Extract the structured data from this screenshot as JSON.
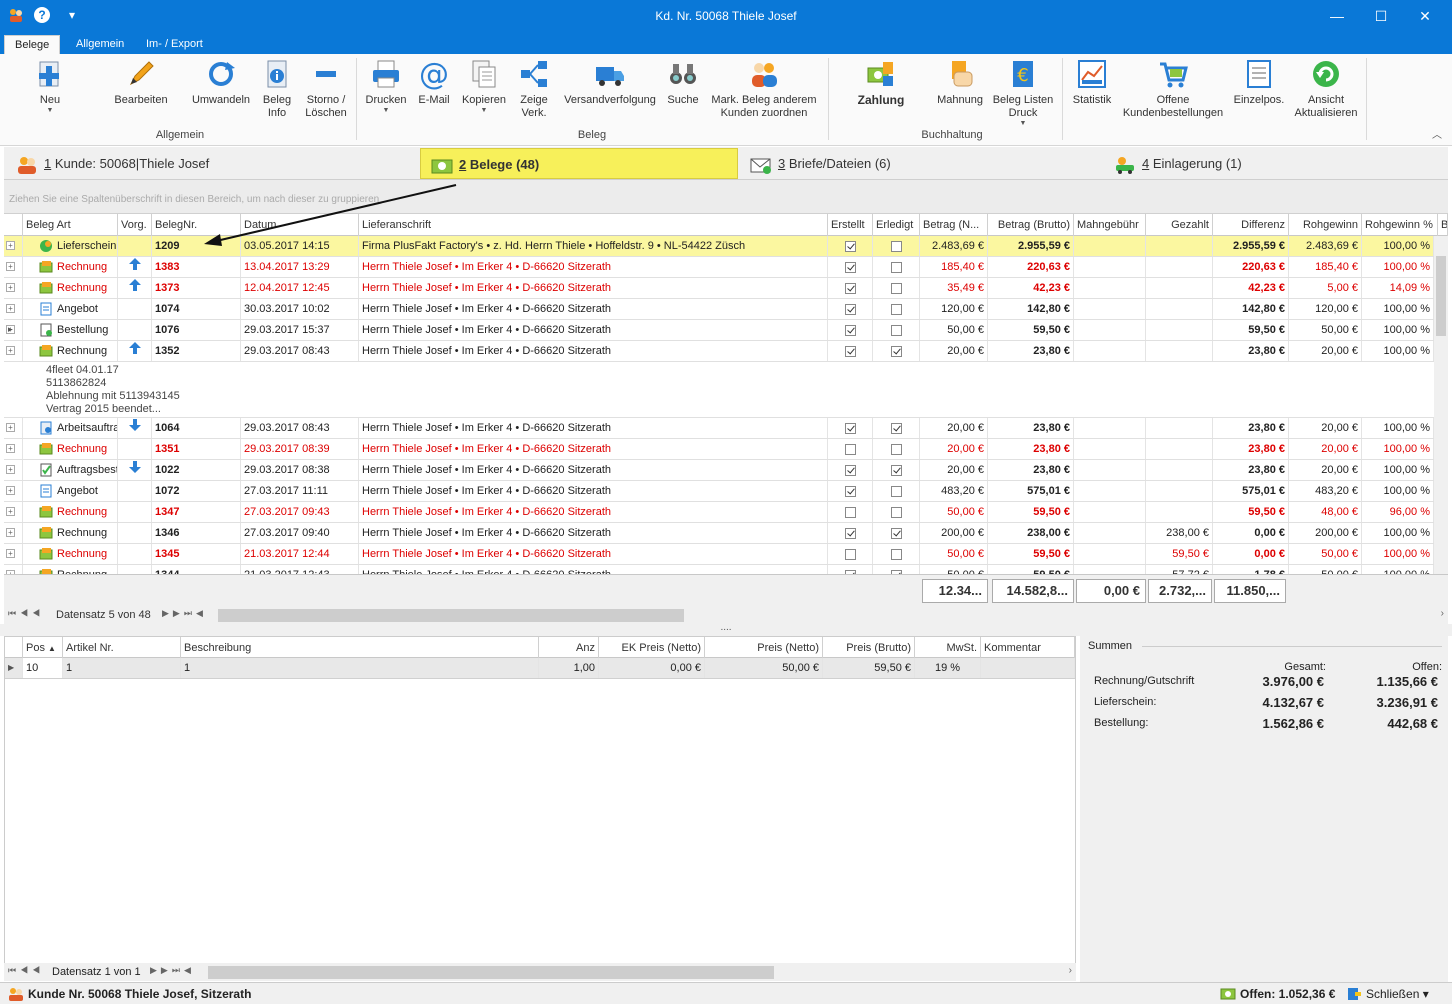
{
  "window": {
    "title": "Kd. Nr. 50068 Thiele Josef",
    "qa_help": "?",
    "qa_menu": "▾",
    "min": "—",
    "max": "☐",
    "close": "✕"
  },
  "ribbon_tabs": [
    "Belege",
    "Allgemein",
    "Im- / Export"
  ],
  "ribbon": {
    "buttons": {
      "neu": "Neu",
      "bearbeiten": "Bearbeiten",
      "umwandeln": "Umwandeln",
      "beleg_info": "Beleg Info",
      "storno": "Storno / Löschen",
      "drucken": "Drucken",
      "email": "E-Mail",
      "kopieren": "Kopieren",
      "zeige": "Zeige Verk.",
      "versand": "Versandverfolgung",
      "suche": "Suche",
      "mark": "Mark. Beleg  anderem Kunden zuordnen",
      "zahlung": "Zahlung",
      "mahnung": "Mahnung",
      "beleglisten": "Beleg Listen Druck",
      "statistik": "Statistik",
      "offene": "Offene Kundenbestellungen",
      "einzelpos": "Einzelpos.",
      "ansicht": "Ansicht Aktualisieren"
    },
    "groups": {
      "allgemein": "Allgemein",
      "beleg": "Beleg",
      "buchhaltung": "Buchhaltung"
    }
  },
  "main_tabs": [
    {
      "num": "1",
      "label": " Kunde: 50068|Thiele Josef"
    },
    {
      "num": "2",
      "label": " Belege (48)"
    },
    {
      "num": "3",
      "label": " Briefe/Dateien (6)"
    },
    {
      "num": "4",
      "label": " Einlagerung (1)"
    }
  ],
  "group_hint": "Ziehen Sie eine Spaltenüberschrift in diesen Bereich, um nach dieser zu gruppieren",
  "columns": [
    "Beleg Art",
    "Vorg.",
    "BelegNr.",
    "Datum",
    "Lieferanschrift",
    "Erstellt",
    "Erledigt",
    "Betrag (N...",
    "Betrag (Brutto)",
    "Mahngebühr",
    "Gezahlt",
    "Differenz",
    "Rohgewinn",
    "Rohgewinn %",
    "B"
  ],
  "rows": [
    {
      "art": "Lieferschein",
      "vorg": "",
      "nr": "1209",
      "datum": "03.05.2017 14:15",
      "anschrift": "Firma PlusFakt Factory's • z. Hd. Herrn Thiele • Hoffeldstr. 9 • NL-54422 Züsch",
      "erstellt": true,
      "erledigt": false,
      "netto": "2.483,69 €",
      "brutto": "2.955,59 €",
      "mahn": "",
      "gezahlt": "",
      "diff": "2.955,59 €",
      "roh": "2.483,69 €",
      "rohp": "100,00 %",
      "sel": true,
      "red": false,
      "type": "liefer"
    },
    {
      "art": "Rechnung",
      "vorg": "up",
      "nr": "1383",
      "datum": "13.04.2017 13:29",
      "anschrift": "Herrn Thiele Josef • Im Erker 4 • D-66620 Sitzerath",
      "erstellt": true,
      "erledigt": false,
      "netto": "185,40 €",
      "brutto": "220,63 €",
      "mahn": "",
      "gezahlt": "",
      "diff": "220,63 €",
      "roh": "185,40 €",
      "rohp": "100,00 %",
      "red": true,
      "type": "rech"
    },
    {
      "art": "Rechnung",
      "vorg": "up",
      "nr": "1373",
      "datum": "12.04.2017 12:45",
      "anschrift": "Herrn Thiele Josef • Im Erker 4 • D-66620 Sitzerath",
      "erstellt": true,
      "erledigt": false,
      "netto": "35,49 €",
      "brutto": "42,23 €",
      "mahn": "",
      "gezahlt": "",
      "diff": "42,23 €",
      "roh": "5,00 €",
      "rohp": "14,09 %",
      "red": true,
      "type": "rech"
    },
    {
      "art": "Angebot",
      "vorg": "",
      "nr": "1074",
      "datum": "30.03.2017 10:02",
      "anschrift": "Herrn Thiele Josef • Im Erker 4 • D-66620 Sitzerath",
      "erstellt": true,
      "erledigt": false,
      "netto": "120,00 €",
      "brutto": "142,80 €",
      "mahn": "",
      "gezahlt": "",
      "diff": "142,80 €",
      "roh": "120,00 €",
      "rohp": "100,00 %",
      "red": false,
      "type": "angebot"
    },
    {
      "art": "Bestellung",
      "vorg": "",
      "nr": "1076",
      "datum": "29.03.2017 15:37",
      "anschrift": "Herrn Thiele Josef • Im Erker 4 • D-66620 Sitzerath",
      "erstellt": true,
      "erledigt": false,
      "netto": "50,00 €",
      "brutto": "59,50 €",
      "mahn": "",
      "gezahlt": "",
      "diff": "59,50 €",
      "roh": "50,00 €",
      "rohp": "100,00 %",
      "red": false,
      "type": "bestell"
    },
    {
      "art": "Rechnung",
      "vorg": "up",
      "nr": "1352",
      "datum": "29.03.2017 08:43",
      "anschrift": "Herrn Thiele Josef • Im Erker 4 • D-66620 Sitzerath",
      "erstellt": true,
      "erledigt": true,
      "netto": "20,00 €",
      "brutto": "23,80 €",
      "mahn": "",
      "gezahlt": "",
      "diff": "23,80 €",
      "roh": "20,00 €",
      "rohp": "100,00 %",
      "red": false,
      "type": "rech"
    }
  ],
  "note_lines": [
    "4fleet 04.01.17",
    "5113862824",
    "Ablehnung mit 5113943145",
    "Vertrag 2015 beendet..."
  ],
  "rows2": [
    {
      "art": "Arbeitsauftrag",
      "vorg": "down",
      "nr": "1064",
      "datum": "29.03.2017 08:43",
      "anschrift": "Herrn Thiele Josef • Im Erker 4 • D-66620 Sitzerath",
      "erstellt": true,
      "erledigt": true,
      "netto": "20,00 €",
      "brutto": "23,80 €",
      "mahn": "",
      "gezahlt": "",
      "diff": "23,80 €",
      "roh": "20,00 €",
      "rohp": "100,00 %",
      "red": false,
      "type": "arbeit"
    },
    {
      "art": "Rechnung",
      "vorg": "",
      "nr": "1351",
      "datum": "29.03.2017 08:39",
      "anschrift": "Herrn Thiele Josef • Im Erker 4 • D-66620 Sitzerath",
      "erstellt": false,
      "erledigt": false,
      "netto": "20,00 €",
      "brutto": "23,80 €",
      "mahn": "",
      "gezahlt": "",
      "diff": "23,80 €",
      "roh": "20,00 €",
      "rohp": "100,00 %",
      "red": true,
      "type": "rech"
    },
    {
      "art": "Auftragsbestätigung",
      "vorg": "down",
      "nr": "1022",
      "datum": "29.03.2017 08:38",
      "anschrift": "Herrn Thiele Josef • Im Erker 4 • D-66620 Sitzerath",
      "erstellt": true,
      "erledigt": true,
      "netto": "20,00 €",
      "brutto": "23,80 €",
      "mahn": "",
      "gezahlt": "",
      "diff": "23,80 €",
      "roh": "20,00 €",
      "rohp": "100,00 %",
      "red": false,
      "type": "auftrag"
    },
    {
      "art": "Angebot",
      "vorg": "",
      "nr": "1072",
      "datum": "27.03.2017 11:11",
      "anschrift": "Herrn Thiele Josef • Im Erker 4 • D-66620 Sitzerath",
      "erstellt": true,
      "erledigt": false,
      "netto": "483,20 €",
      "brutto": "575,01 €",
      "mahn": "",
      "gezahlt": "",
      "diff": "575,01 €",
      "roh": "483,20 €",
      "rohp": "100,00 %",
      "red": false,
      "type": "angebot"
    },
    {
      "art": "Rechnung",
      "vorg": "",
      "nr": "1347",
      "datum": "27.03.2017 09:43",
      "anschrift": "Herrn Thiele Josef • Im Erker 4 • D-66620 Sitzerath",
      "erstellt": false,
      "erledigt": false,
      "netto": "50,00 €",
      "brutto": "59,50 €",
      "mahn": "",
      "gezahlt": "",
      "diff": "59,50 €",
      "roh": "48,00 €",
      "rohp": "96,00 %",
      "red": true,
      "type": "rech"
    },
    {
      "art": "Rechnung",
      "vorg": "",
      "nr": "1346",
      "datum": "27.03.2017 09:40",
      "anschrift": "Herrn Thiele Josef • Im Erker 4 • D-66620 Sitzerath",
      "erstellt": true,
      "erledigt": true,
      "netto": "200,00 €",
      "brutto": "238,00 €",
      "mahn": "",
      "gezahlt": "238,00 €",
      "diff": "0,00 €",
      "roh": "200,00 €",
      "rohp": "100,00 %",
      "red": false,
      "type": "rech"
    },
    {
      "art": "Rechnung",
      "vorg": "",
      "nr": "1345",
      "datum": "21.03.2017 12:44",
      "anschrift": "Herrn Thiele Josef • Im Erker 4 • D-66620 Sitzerath",
      "erstellt": false,
      "erledigt": false,
      "netto": "50,00 €",
      "brutto": "59,50 €",
      "mahn": "",
      "gezahlt": "59,50 €",
      "diff": "0,00 €",
      "roh": "50,00 €",
      "rohp": "100,00 %",
      "red": true,
      "type": "rech"
    },
    {
      "art": "Rechnung",
      "vorg": "",
      "nr": "1344",
      "datum": "21.03.2017 12:43",
      "anschrift": "Herrn Thiele Josef • Im Erker 4 • D-66620 Sitzerath",
      "erstellt": true,
      "erledigt": true,
      "netto": "50,00 €",
      "brutto": "59,50 €",
      "mahn": "",
      "gezahlt": "57,72 €",
      "diff": "1,78 €",
      "roh": "50,00 €",
      "rohp": "100,00 %",
      "red": false,
      "type": "rech"
    }
  ],
  "totals": [
    "12.34...",
    "14.582,8...",
    "0,00 €",
    "2.732,...",
    "11.850,..."
  ],
  "nav1": "Datensatz 5 von 48",
  "pos_columns": [
    "Pos",
    "Artikel Nr.",
    "Beschreibung",
    "Anz",
    "EK Preis (Netto)",
    "Preis (Netto)",
    "Preis (Brutto)",
    "MwSt.",
    "Kommentar"
  ],
  "pos_row": {
    "pos": "10",
    "artikel": "1",
    "beschreibung": "1",
    "anz": "1,00",
    "ek": "0,00 €",
    "netto": "50,00 €",
    "brutto": "59,50 €",
    "mwst": "19 %",
    "kommentar": ""
  },
  "nav2": "Datensatz 1 von 1",
  "summen": {
    "title": "Summen",
    "gesamt_label": "Gesamt:",
    "offen_label": "Offen:",
    "rows": [
      {
        "label": "Rechnung/Gutschrift",
        "gesamt": "3.976,00 €",
        "offen": "1.135,66 €"
      },
      {
        "label": "Lieferschein:",
        "gesamt": "4.132,67 €",
        "offen": "3.236,91 €"
      },
      {
        "label": "Bestellung:",
        "gesamt": "1.562,86 €",
        "offen": "442,68 €"
      }
    ]
  },
  "status": {
    "left": "Kunde Nr. 50068 Thiele Josef, Sitzerath",
    "offen": "Offen: 1.052,36 €",
    "schliessen": "Schließen ▾"
  },
  "colors": {
    "accent": "#0a78d7",
    "selected": "#fbf7a0",
    "red": "#dd0000"
  }
}
